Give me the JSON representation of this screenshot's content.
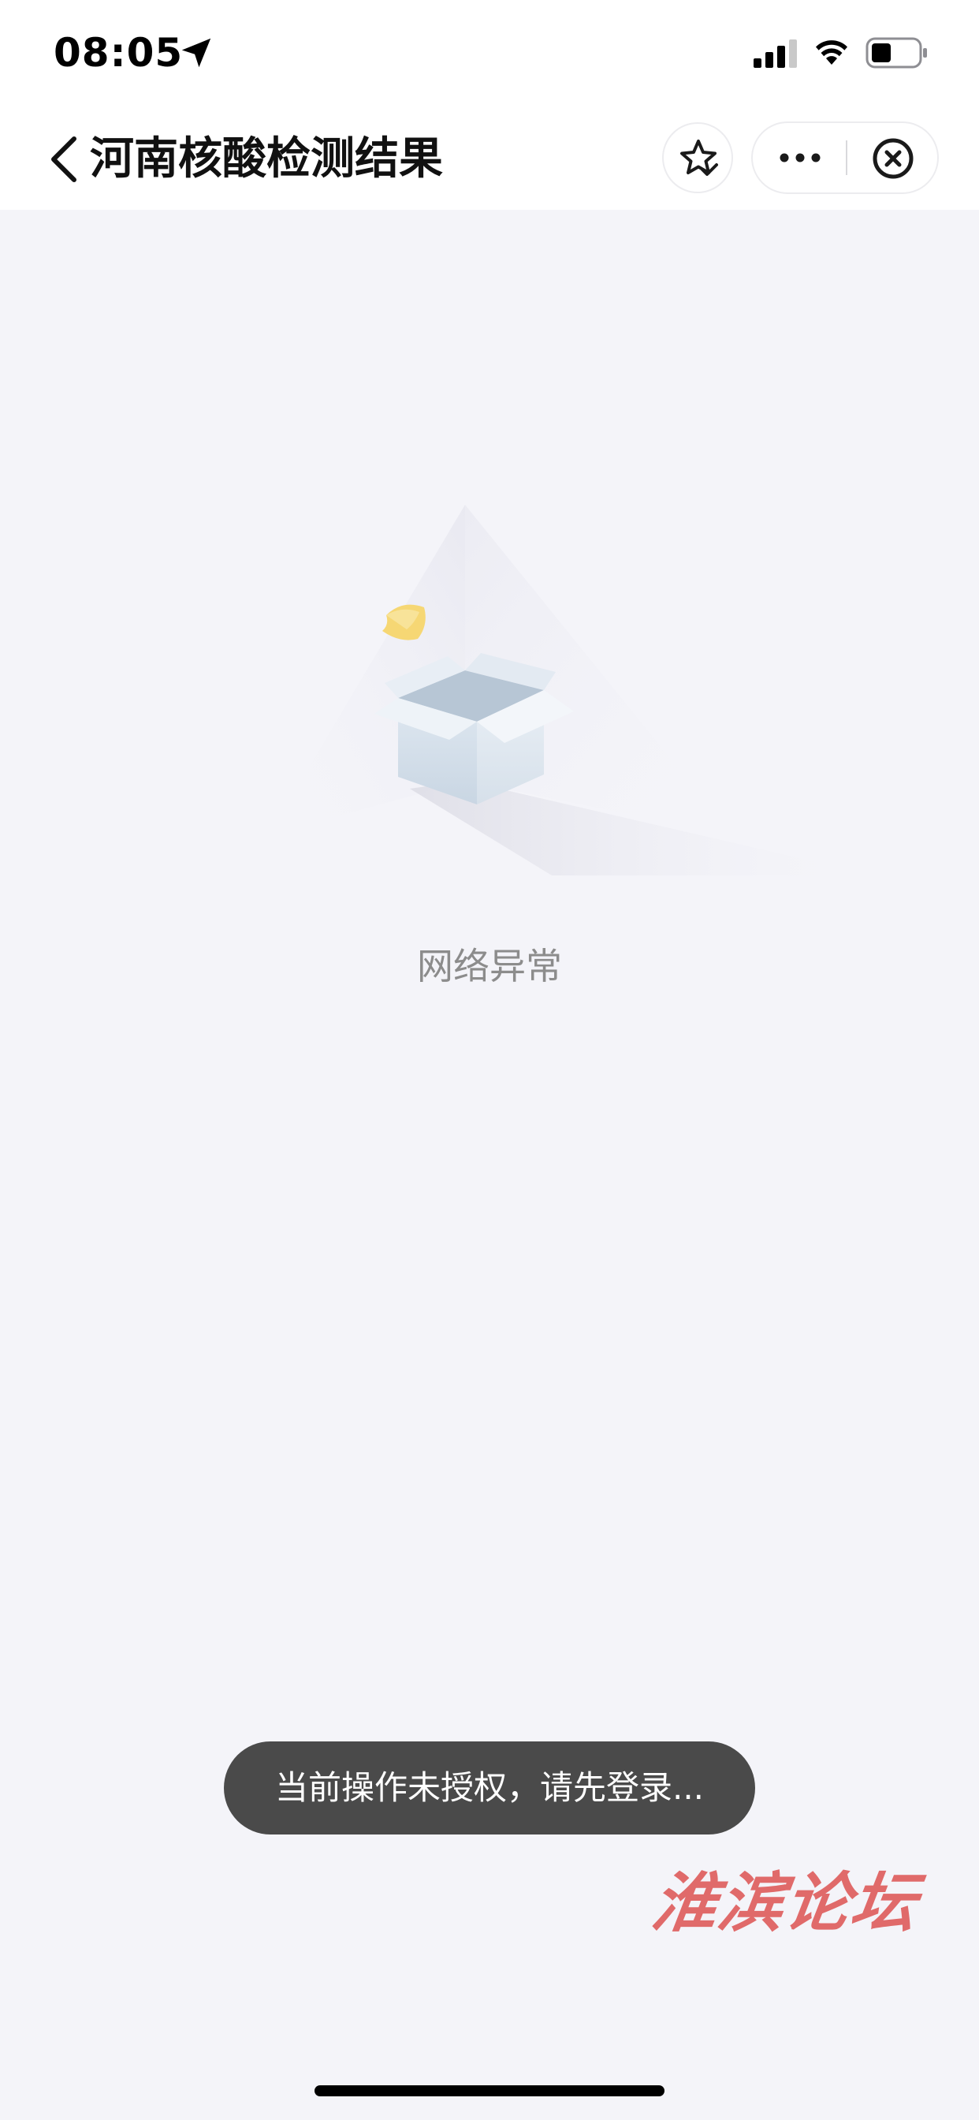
{
  "status_bar": {
    "time": "08:05",
    "icons": [
      "location-arrow-icon",
      "cellular-signal-icon",
      "wifi-icon",
      "battery-icon"
    ]
  },
  "nav": {
    "title": "河南核酸检测结果",
    "back_icon": "chevron-left-icon",
    "favorite_icon": "star-check-icon",
    "more_icon": "more-dots-icon",
    "close_icon": "close-circle-icon"
  },
  "main": {
    "illustration": "empty-box-illustration",
    "error_message": "网络异常"
  },
  "toast": {
    "message": "当前操作未授权，请先登录..."
  },
  "watermark": {
    "text": "淮滨论坛"
  },
  "colors": {
    "page_background": "#f4f4f9",
    "header_background": "#ffffff",
    "toast_background": "#4a4a4a",
    "error_text": "#8c8c8c",
    "watermark": "#e06a6a"
  }
}
